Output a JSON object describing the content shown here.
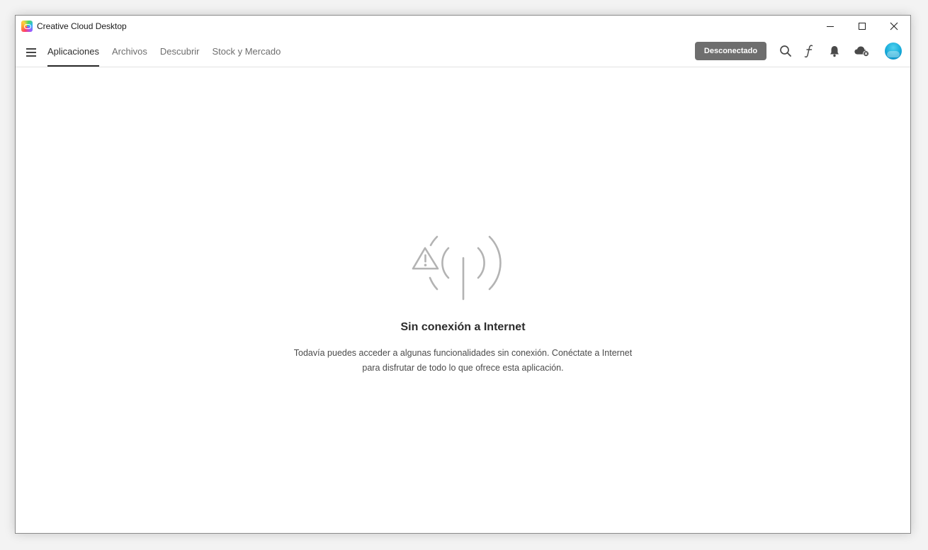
{
  "window": {
    "title": "Creative Cloud Desktop"
  },
  "nav": {
    "tabs": [
      {
        "label": "Aplicaciones",
        "active": true
      },
      {
        "label": "Archivos",
        "active": false
      },
      {
        "label": "Descubrir",
        "active": false
      },
      {
        "label": "Stock y Mercado",
        "active": false
      }
    ]
  },
  "header": {
    "status_label": "Desconectado",
    "icons": [
      "search-icon",
      "fonts-icon",
      "bell-icon",
      "cloud-offline-icon",
      "avatar"
    ]
  },
  "empty_state": {
    "title": "Sin conexión a Internet",
    "line1": "Todavía puedes acceder a algunas funcionalidades sin conexión. Conéctate a Internet",
    "line2": "para disfrutar de todo lo que ofrece esta aplicación."
  },
  "colors": {
    "status_button": "#6e6e6e",
    "avatar": "#14a9d8",
    "illustration": "#b3b3b3"
  }
}
